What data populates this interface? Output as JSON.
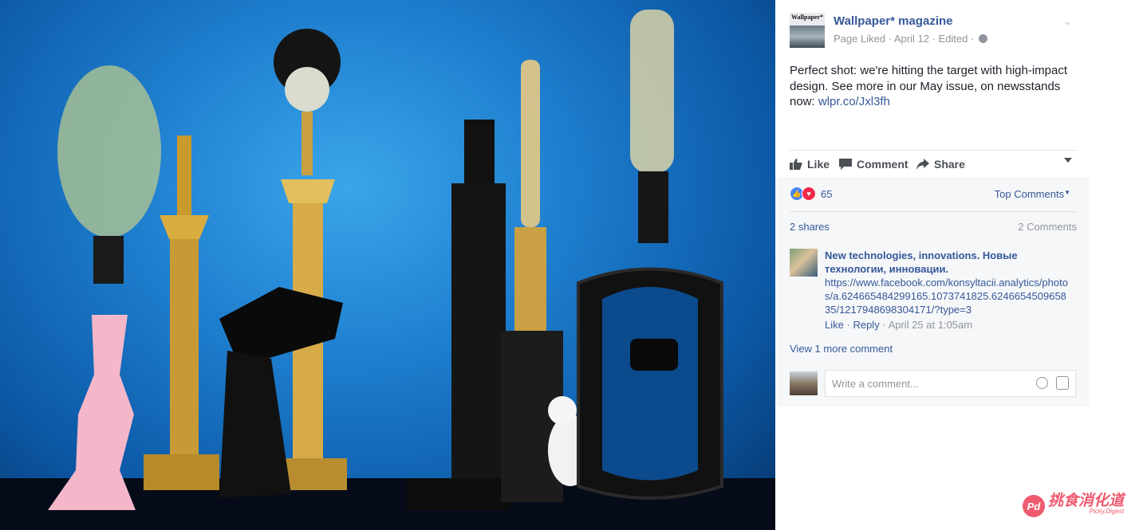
{
  "post": {
    "page_name": "Wallpaper* magazine",
    "thumb_masthead": "Wallpaper*",
    "meta": "Page Liked · April 12 · Edited ·",
    "text": "Perfect shot: we're hitting the target with high-impact design. See more in our May issue, on newsstands now: ",
    "link": "wlpr.co/Jxl3fh"
  },
  "actions": {
    "like": "Like",
    "comment": "Comment",
    "share": "Share"
  },
  "reactions": {
    "count": "65",
    "top_comments": "Top Comments",
    "shares": "2 shares",
    "comments": "2 Comments"
  },
  "comment": {
    "author": "New technologies, innovations. Новые технологии, инновации.",
    "text": "https://www.facebook.com/konsyltacii.analytics/photos/a.624665484299165.1073741825.624665450965835/1217948698304171/?type=3",
    "like": "Like",
    "reply": "Reply",
    "time": "April 25 at 1:05am"
  },
  "view_more": "View 1 more comment",
  "composer": {
    "placeholder": "Write a comment..."
  },
  "watermark": {
    "logo": "Pd",
    "cn": "挑食消化道",
    "en": "Picky.Digest"
  },
  "colors": {
    "link": "#365899",
    "photo_bg": "#1f7fcf",
    "watermark": "#ef5a6f"
  }
}
